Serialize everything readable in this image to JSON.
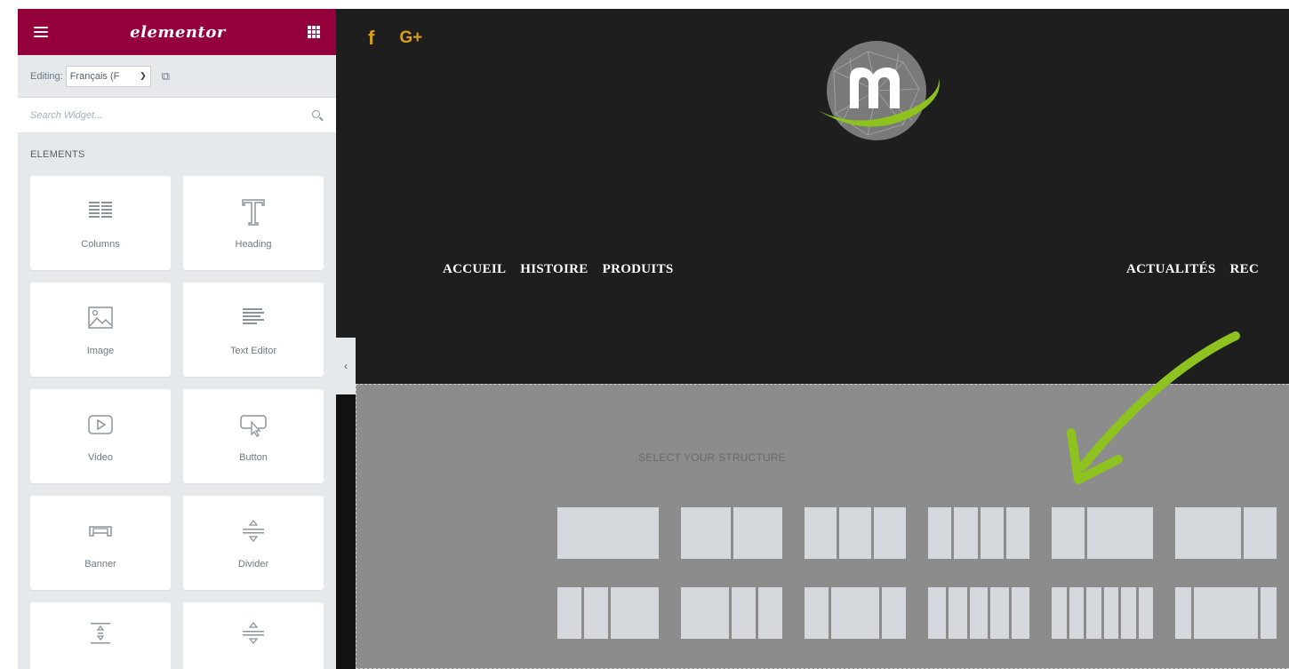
{
  "panel": {
    "logo": "elementor",
    "editing_label": "Editing:",
    "language_value": "Français (F",
    "search_placeholder": "Search Widget...",
    "section_heading": "ELEMENTS",
    "widgets": [
      {
        "label": "Columns",
        "icon": "columns-icon"
      },
      {
        "label": "Heading",
        "icon": "heading-icon"
      },
      {
        "label": "Image",
        "icon": "image-icon"
      },
      {
        "label": "Text Editor",
        "icon": "text-editor-icon"
      },
      {
        "label": "Video",
        "icon": "video-icon"
      },
      {
        "label": "Button",
        "icon": "button-icon"
      },
      {
        "label": "Banner",
        "icon": "banner-icon"
      },
      {
        "label": "Divider",
        "icon": "divider-icon"
      },
      {
        "label": "",
        "icon": "spacer-icon"
      },
      {
        "label": "",
        "icon": "divider-icon"
      }
    ],
    "colors": {
      "header": "#93003c",
      "background": "#e6e9ec"
    }
  },
  "preview": {
    "social": {
      "facebook": "f",
      "googleplus": "G+"
    },
    "nav_left": [
      "ACCUEIL",
      "HISTOIRE",
      "PRODUITS"
    ],
    "nav_right": [
      "ACTUALITÉS",
      "REC"
    ],
    "structure_title": "SELECT YOUR STRUCTURE",
    "collapse_glyph": "‹",
    "colors": {
      "header_bg": "#1e1e1e",
      "social": "#d4a017",
      "arrow": "#8dc21f",
      "structure_bg": "#8c8c8c"
    }
  }
}
